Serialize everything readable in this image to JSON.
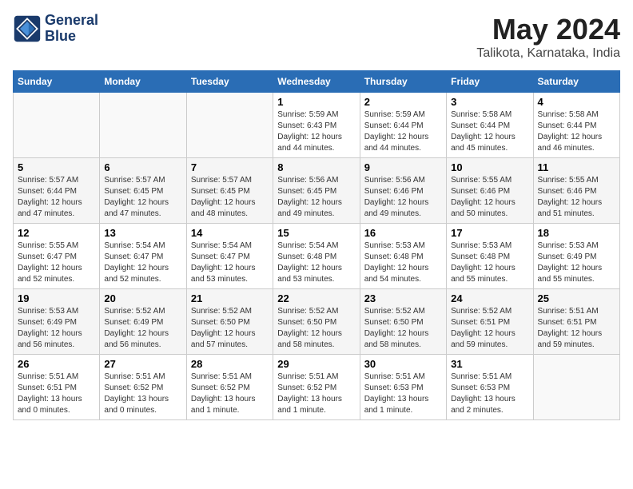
{
  "logo": {
    "line1": "General",
    "line2": "Blue"
  },
  "title": "May 2024",
  "subtitle": "Talikota, Karnataka, India",
  "headers": [
    "Sunday",
    "Monday",
    "Tuesday",
    "Wednesday",
    "Thursday",
    "Friday",
    "Saturday"
  ],
  "weeks": [
    [
      {
        "day": "",
        "sunrise": "",
        "sunset": "",
        "daylight": ""
      },
      {
        "day": "",
        "sunrise": "",
        "sunset": "",
        "daylight": ""
      },
      {
        "day": "",
        "sunrise": "",
        "sunset": "",
        "daylight": ""
      },
      {
        "day": "1",
        "sunrise": "Sunrise: 5:59 AM",
        "sunset": "Sunset: 6:43 PM",
        "daylight": "Daylight: 12 hours and 44 minutes."
      },
      {
        "day": "2",
        "sunrise": "Sunrise: 5:59 AM",
        "sunset": "Sunset: 6:44 PM",
        "daylight": "Daylight: 12 hours and 44 minutes."
      },
      {
        "day": "3",
        "sunrise": "Sunrise: 5:58 AM",
        "sunset": "Sunset: 6:44 PM",
        "daylight": "Daylight: 12 hours and 45 minutes."
      },
      {
        "day": "4",
        "sunrise": "Sunrise: 5:58 AM",
        "sunset": "Sunset: 6:44 PM",
        "daylight": "Daylight: 12 hours and 46 minutes."
      }
    ],
    [
      {
        "day": "5",
        "sunrise": "Sunrise: 5:57 AM",
        "sunset": "Sunset: 6:44 PM",
        "daylight": "Daylight: 12 hours and 47 minutes."
      },
      {
        "day": "6",
        "sunrise": "Sunrise: 5:57 AM",
        "sunset": "Sunset: 6:45 PM",
        "daylight": "Daylight: 12 hours and 47 minutes."
      },
      {
        "day": "7",
        "sunrise": "Sunrise: 5:57 AM",
        "sunset": "Sunset: 6:45 PM",
        "daylight": "Daylight: 12 hours and 48 minutes."
      },
      {
        "day": "8",
        "sunrise": "Sunrise: 5:56 AM",
        "sunset": "Sunset: 6:45 PM",
        "daylight": "Daylight: 12 hours and 49 minutes."
      },
      {
        "day": "9",
        "sunrise": "Sunrise: 5:56 AM",
        "sunset": "Sunset: 6:46 PM",
        "daylight": "Daylight: 12 hours and 49 minutes."
      },
      {
        "day": "10",
        "sunrise": "Sunrise: 5:55 AM",
        "sunset": "Sunset: 6:46 PM",
        "daylight": "Daylight: 12 hours and 50 minutes."
      },
      {
        "day": "11",
        "sunrise": "Sunrise: 5:55 AM",
        "sunset": "Sunset: 6:46 PM",
        "daylight": "Daylight: 12 hours and 51 minutes."
      }
    ],
    [
      {
        "day": "12",
        "sunrise": "Sunrise: 5:55 AM",
        "sunset": "Sunset: 6:47 PM",
        "daylight": "Daylight: 12 hours and 52 minutes."
      },
      {
        "day": "13",
        "sunrise": "Sunrise: 5:54 AM",
        "sunset": "Sunset: 6:47 PM",
        "daylight": "Daylight: 12 hours and 52 minutes."
      },
      {
        "day": "14",
        "sunrise": "Sunrise: 5:54 AM",
        "sunset": "Sunset: 6:47 PM",
        "daylight": "Daylight: 12 hours and 53 minutes."
      },
      {
        "day": "15",
        "sunrise": "Sunrise: 5:54 AM",
        "sunset": "Sunset: 6:48 PM",
        "daylight": "Daylight: 12 hours and 53 minutes."
      },
      {
        "day": "16",
        "sunrise": "Sunrise: 5:53 AM",
        "sunset": "Sunset: 6:48 PM",
        "daylight": "Daylight: 12 hours and 54 minutes."
      },
      {
        "day": "17",
        "sunrise": "Sunrise: 5:53 AM",
        "sunset": "Sunset: 6:48 PM",
        "daylight": "Daylight: 12 hours and 55 minutes."
      },
      {
        "day": "18",
        "sunrise": "Sunrise: 5:53 AM",
        "sunset": "Sunset: 6:49 PM",
        "daylight": "Daylight: 12 hours and 55 minutes."
      }
    ],
    [
      {
        "day": "19",
        "sunrise": "Sunrise: 5:53 AM",
        "sunset": "Sunset: 6:49 PM",
        "daylight": "Daylight: 12 hours and 56 minutes."
      },
      {
        "day": "20",
        "sunrise": "Sunrise: 5:52 AM",
        "sunset": "Sunset: 6:49 PM",
        "daylight": "Daylight: 12 hours and 56 minutes."
      },
      {
        "day": "21",
        "sunrise": "Sunrise: 5:52 AM",
        "sunset": "Sunset: 6:50 PM",
        "daylight": "Daylight: 12 hours and 57 minutes."
      },
      {
        "day": "22",
        "sunrise": "Sunrise: 5:52 AM",
        "sunset": "Sunset: 6:50 PM",
        "daylight": "Daylight: 12 hours and 58 minutes."
      },
      {
        "day": "23",
        "sunrise": "Sunrise: 5:52 AM",
        "sunset": "Sunset: 6:50 PM",
        "daylight": "Daylight: 12 hours and 58 minutes."
      },
      {
        "day": "24",
        "sunrise": "Sunrise: 5:52 AM",
        "sunset": "Sunset: 6:51 PM",
        "daylight": "Daylight: 12 hours and 59 minutes."
      },
      {
        "day": "25",
        "sunrise": "Sunrise: 5:51 AM",
        "sunset": "Sunset: 6:51 PM",
        "daylight": "Daylight: 12 hours and 59 minutes."
      }
    ],
    [
      {
        "day": "26",
        "sunrise": "Sunrise: 5:51 AM",
        "sunset": "Sunset: 6:51 PM",
        "daylight": "Daylight: 13 hours and 0 minutes."
      },
      {
        "day": "27",
        "sunrise": "Sunrise: 5:51 AM",
        "sunset": "Sunset: 6:52 PM",
        "daylight": "Daylight: 13 hours and 0 minutes."
      },
      {
        "day": "28",
        "sunrise": "Sunrise: 5:51 AM",
        "sunset": "Sunset: 6:52 PM",
        "daylight": "Daylight: 13 hours and 1 minute."
      },
      {
        "day": "29",
        "sunrise": "Sunrise: 5:51 AM",
        "sunset": "Sunset: 6:52 PM",
        "daylight": "Daylight: 13 hours and 1 minute."
      },
      {
        "day": "30",
        "sunrise": "Sunrise: 5:51 AM",
        "sunset": "Sunset: 6:53 PM",
        "daylight": "Daylight: 13 hours and 1 minute."
      },
      {
        "day": "31",
        "sunrise": "Sunrise: 5:51 AM",
        "sunset": "Sunset: 6:53 PM",
        "daylight": "Daylight: 13 hours and 2 minutes."
      },
      {
        "day": "",
        "sunrise": "",
        "sunset": "",
        "daylight": ""
      }
    ]
  ]
}
